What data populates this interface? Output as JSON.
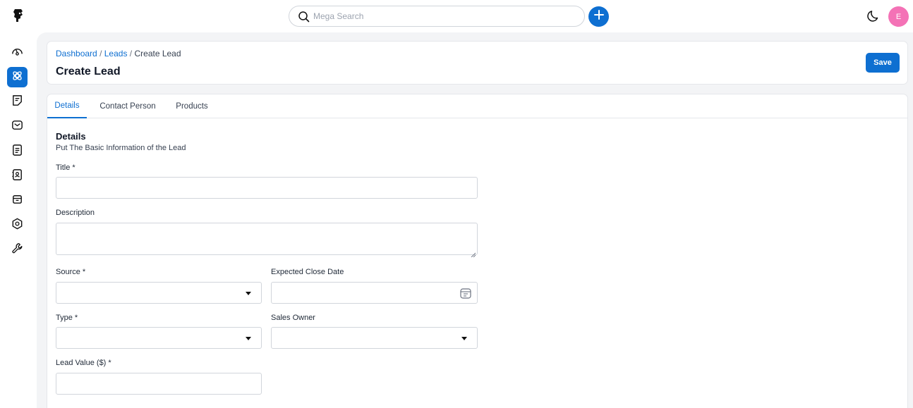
{
  "header": {
    "search_placeholder": "Mega Search",
    "avatar_initial": "E"
  },
  "breadcrumb": {
    "items": [
      "Dashboard",
      "Leads",
      "Create Lead"
    ],
    "separator": "/"
  },
  "page": {
    "title": "Create Lead",
    "save_label": "Save"
  },
  "tabs": [
    "Details",
    "Contact Person",
    "Products"
  ],
  "details": {
    "heading": "Details",
    "subheading": "Put The Basic Information of the Lead"
  },
  "form": {
    "title_label": "Title *",
    "description_label": "Description",
    "source_label": "Source *",
    "expected_close_date_label": "Expected Close Date",
    "type_label": "Type *",
    "sales_owner_label": "Sales Owner",
    "lead_value_label": "Lead Value ($) *"
  },
  "sidebar": {
    "items": [
      "dashboard-icon",
      "leads-icon",
      "quotes-icon",
      "mail-icon",
      "activities-icon",
      "contacts-icon",
      "products-icon",
      "settings-icon",
      "configuration-icon"
    ],
    "active": "leads-icon"
  },
  "colors": {
    "accent": "#0e6fd1",
    "avatar": "#f472b6",
    "background": "#f3f4f6"
  }
}
